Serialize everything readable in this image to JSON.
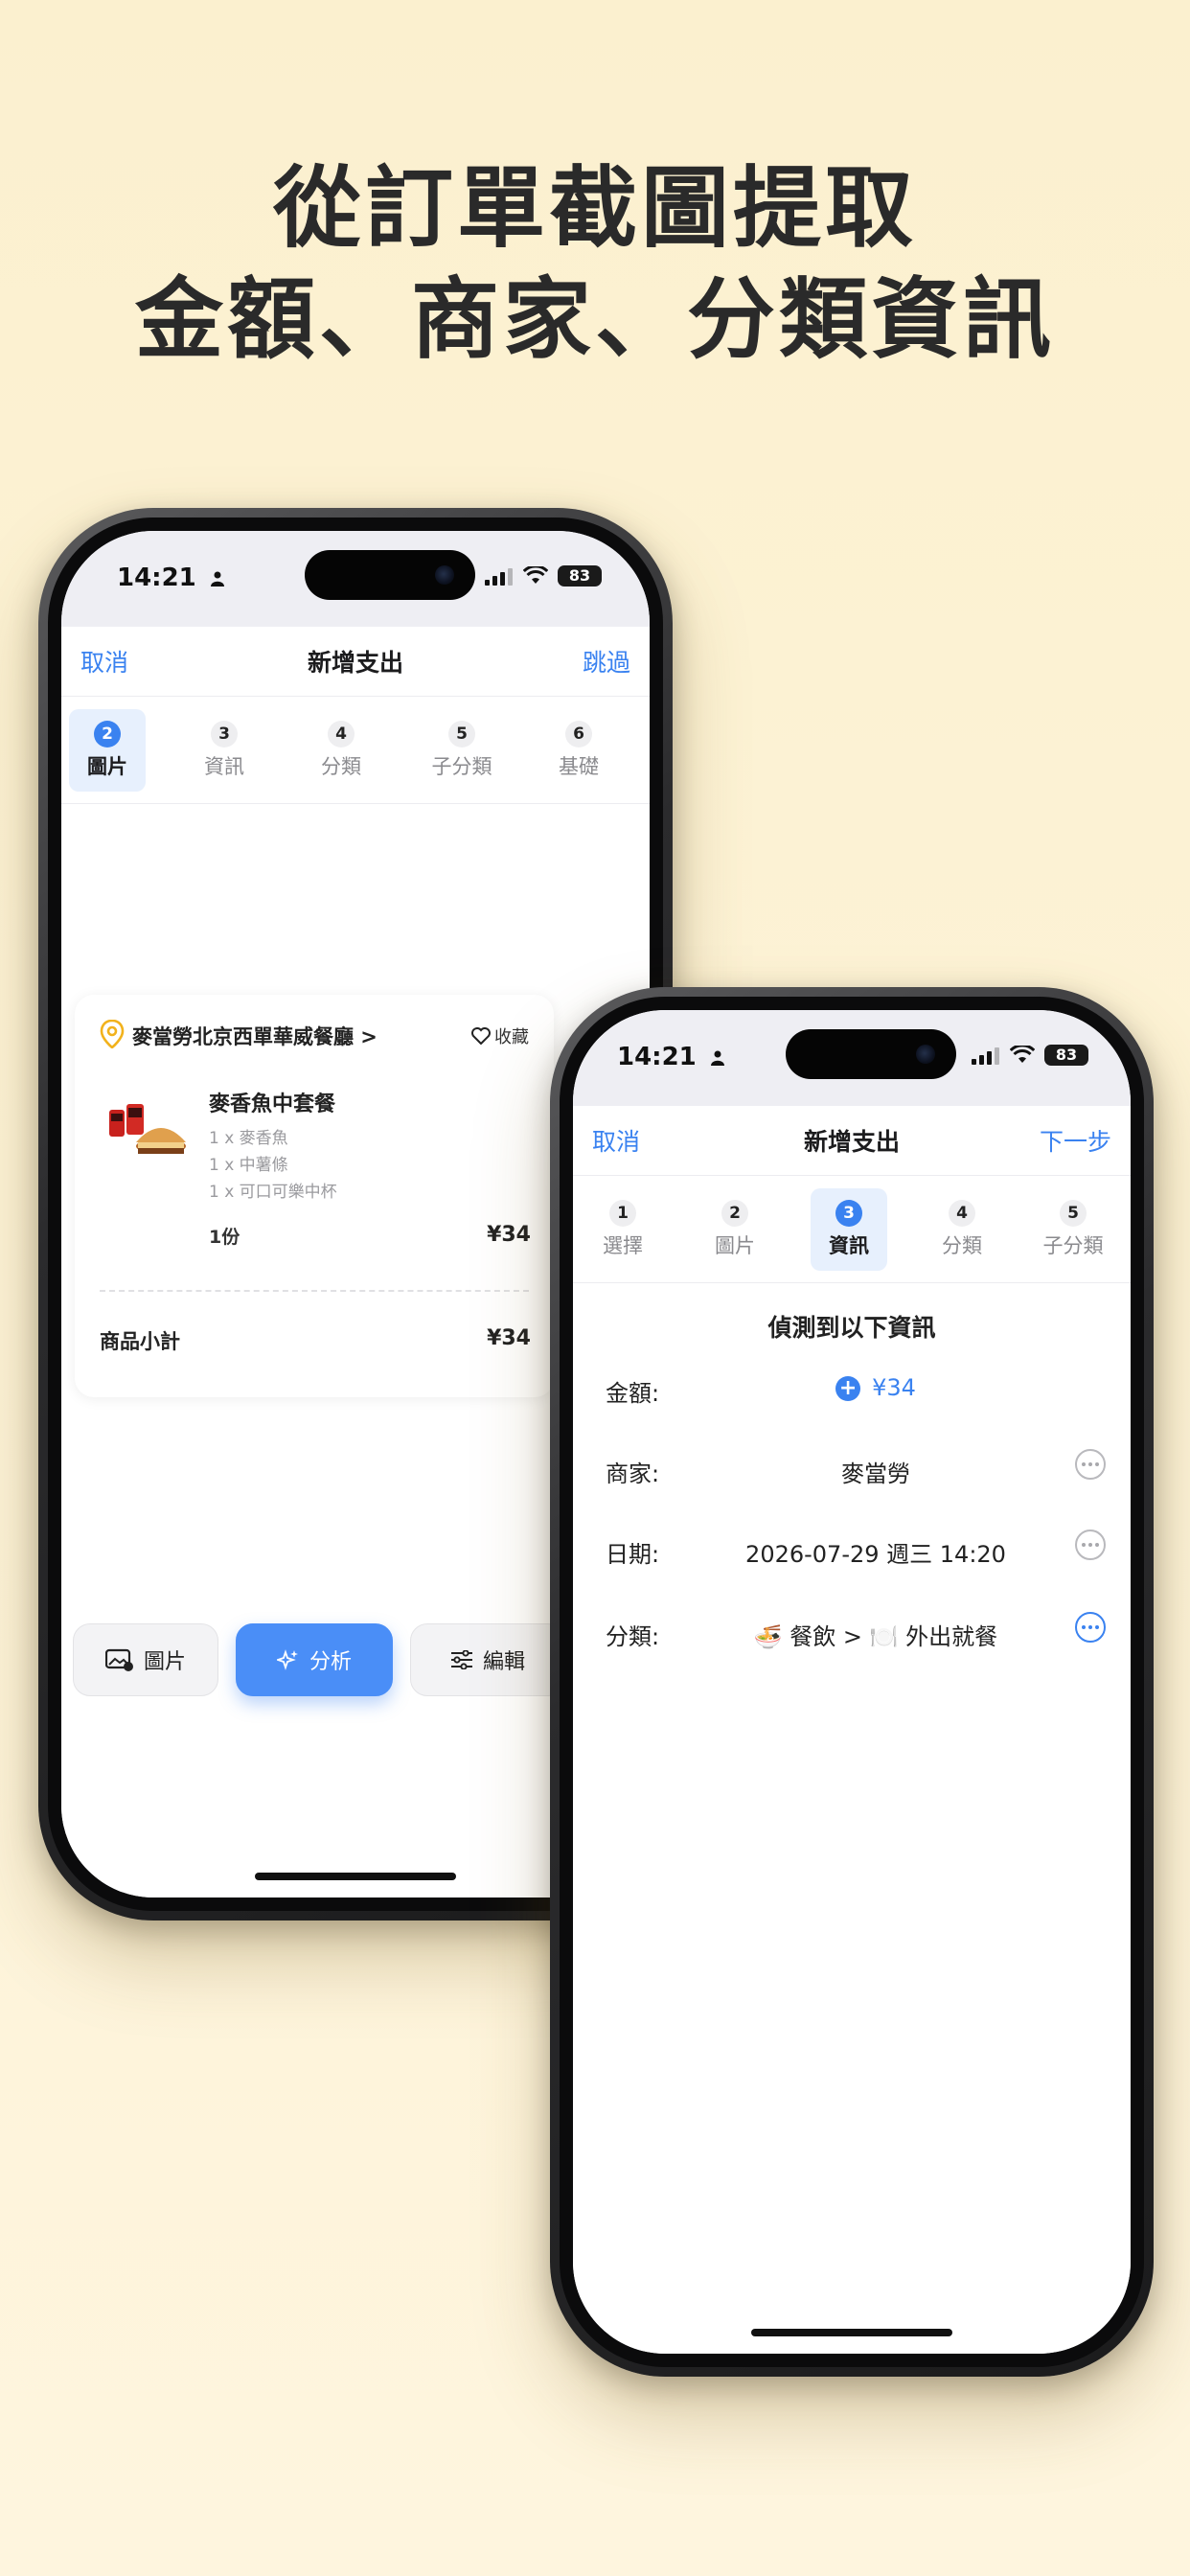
{
  "headline": {
    "line1": "從訂單截圖提取",
    "line2": "金額、商家、分類資訊"
  },
  "phone1": {
    "status": {
      "time": "14:21",
      "battery": "83"
    },
    "nav": {
      "cancel": "取消",
      "title": "新增支出",
      "skip": "跳過"
    },
    "steps": [
      {
        "num": "2",
        "label": "圖片",
        "active": true
      },
      {
        "num": "3",
        "label": "資訊"
      },
      {
        "num": "4",
        "label": "分類"
      },
      {
        "num": "5",
        "label": "子分類"
      },
      {
        "num": "6",
        "label": "基礎"
      }
    ],
    "receipt": {
      "store": "麥當勞北京西單華威餐廳 >",
      "favorite": "收藏",
      "meal_name": "麥香魚中套餐",
      "items": [
        "1 x 麥香魚",
        "1 x 中薯條",
        "1 x 可口可樂中杯"
      ],
      "qty": "1份",
      "price": "¥34",
      "subtotal_label": "商品小計",
      "subtotal_value": "¥34"
    },
    "buttons": {
      "image": "圖片",
      "analyze": "分析",
      "edit": "編輯"
    }
  },
  "phone2": {
    "status": {
      "time": "14:21",
      "battery": "83"
    },
    "nav": {
      "cancel": "取消",
      "title": "新增支出",
      "next": "下一步"
    },
    "steps": [
      {
        "num": "1",
        "label": "選擇"
      },
      {
        "num": "2",
        "label": "圖片"
      },
      {
        "num": "3",
        "label": "資訊",
        "active": true
      },
      {
        "num": "4",
        "label": "分類"
      },
      {
        "num": "5",
        "label": "子分類"
      }
    ],
    "detected_title": "偵測到以下資訊",
    "fields": {
      "amount_label": "金額:",
      "amount_value": "¥34",
      "merchant_label": "商家:",
      "merchant_value": "麥當勞",
      "date_label": "日期:",
      "date_value": "2026-07-29 週三 14:20",
      "category_label": "分類:",
      "category_value": "🍜 餐飲 > 🍽️ 外出就餐"
    }
  },
  "colors": {
    "accent": "#3a82f0",
    "background": "#fdf3d6"
  }
}
